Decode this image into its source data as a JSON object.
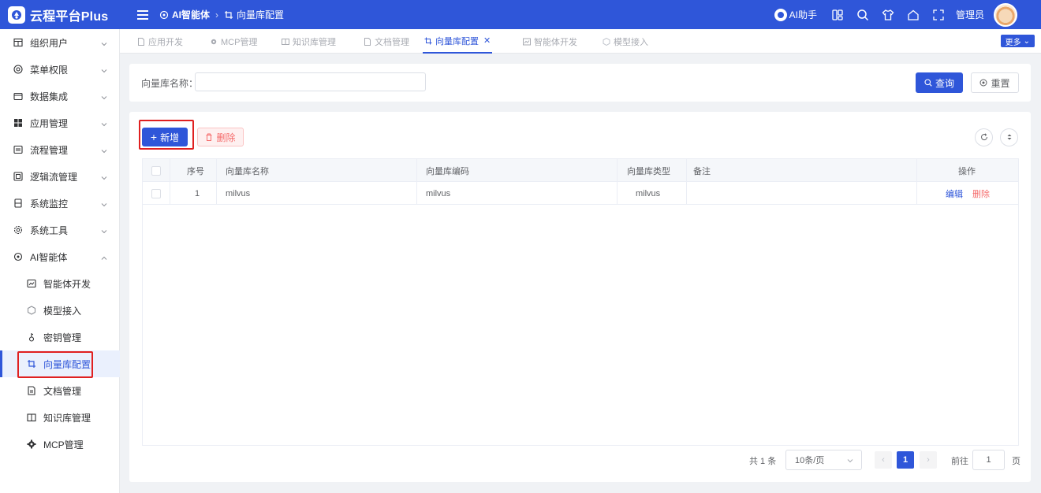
{
  "app": {
    "title": "云程平台Plus",
    "breadcrumb": [
      "AI智能体",
      "向量库配置"
    ],
    "ai_helper": "AI助手",
    "user": "管理员",
    "accent": "#2f56d9",
    "danger": "#f56c6c"
  },
  "top_icons": [
    "apps-icon",
    "search-icon",
    "shirt-icon",
    "home-icon",
    "fullscreen-icon"
  ],
  "sidebar": {
    "items": [
      {
        "label": "组织用户",
        "icon": "org-icon",
        "expanded": false
      },
      {
        "label": "菜单权限",
        "icon": "menu-permission-icon",
        "expanded": false
      },
      {
        "label": "数据集成",
        "icon": "data-integration-icon",
        "expanded": false
      },
      {
        "label": "应用管理",
        "icon": "app-grid-icon",
        "expanded": false
      },
      {
        "label": "流程管理",
        "icon": "flow-icon",
        "expanded": false
      },
      {
        "label": "逻辑流管理",
        "icon": "logic-flow-icon",
        "expanded": false
      },
      {
        "label": "系统监控",
        "icon": "monitor-icon",
        "expanded": false
      },
      {
        "label": "系统工具",
        "icon": "tools-icon",
        "expanded": false
      },
      {
        "label": "AI智能体",
        "icon": "ai-agent-icon",
        "expanded": true
      }
    ],
    "sub_items": [
      {
        "label": "智能体开发",
        "icon": "agent-dev-icon"
      },
      {
        "label": "模型接入",
        "icon": "model-icon"
      },
      {
        "label": "密钥管理",
        "icon": "key-icon"
      },
      {
        "label": "向量库配置",
        "icon": "vector-icon",
        "active": true
      },
      {
        "label": "文档管理",
        "icon": "document-icon"
      },
      {
        "label": "知识库管理",
        "icon": "book-icon"
      },
      {
        "label": "MCP管理",
        "icon": "gear-icon"
      }
    ]
  },
  "tabs": [
    {
      "label": "应用开发",
      "icon": "file-icon"
    },
    {
      "label": "MCP管理",
      "icon": "gear-icon"
    },
    {
      "label": "知识库管理",
      "icon": "book-icon"
    },
    {
      "label": "文档管理",
      "icon": "file-icon"
    },
    {
      "label": "向量库配置",
      "icon": "vector-icon",
      "active": true,
      "closable": true
    },
    {
      "label": "智能体开发",
      "icon": "agent-dev-icon"
    },
    {
      "label": "模型接入",
      "icon": "model-icon"
    }
  ],
  "more_button": "更多",
  "search": {
    "label": "向量库名称：",
    "value": "",
    "placeholder": "",
    "query_button": "查询",
    "reset_button": "重置"
  },
  "toolbar": {
    "add_button": "新增",
    "delete_button": "删除"
  },
  "table": {
    "columns": [
      "序号",
      "向量库名称",
      "向量库编码",
      "向量库类型",
      "备注",
      "操作"
    ],
    "rows": [
      {
        "index": "1",
        "name": "milvus",
        "code": "milvus",
        "type": "milvus",
        "remark": "",
        "edit": "编辑",
        "delete": "删除"
      }
    ]
  },
  "pagination": {
    "total": "共 1 条",
    "page_size": "10条/页",
    "current": "1",
    "goto_label": "前往",
    "goto_value": "1",
    "page_unit": "页"
  }
}
